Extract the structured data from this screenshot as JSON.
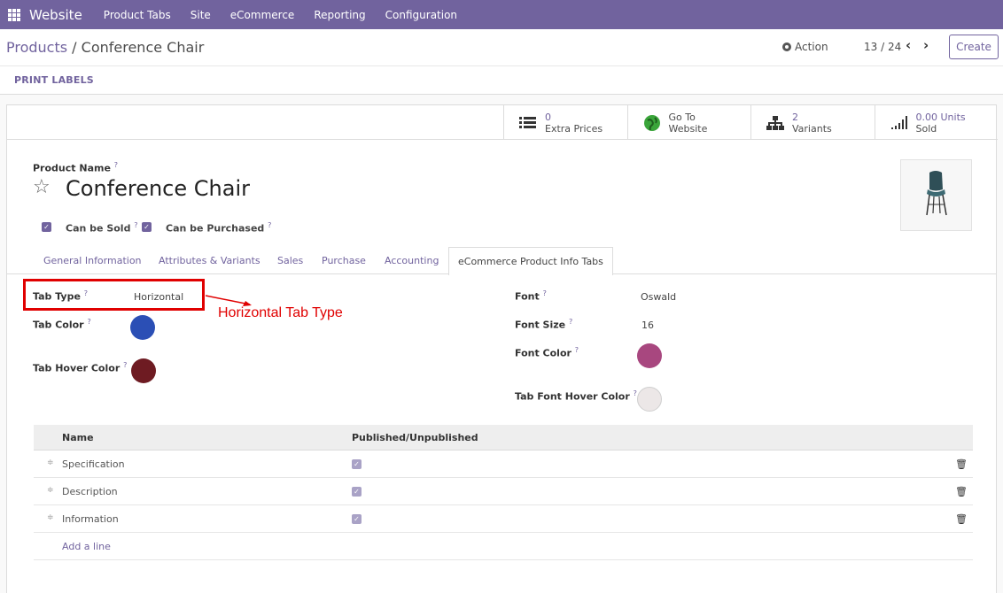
{
  "navbar": {
    "brand": "Website",
    "items": [
      "Product Tabs",
      "Site",
      "eCommerce",
      "Reporting",
      "Configuration"
    ]
  },
  "breadcrumb": {
    "parent": "Products",
    "separator": " / ",
    "current": "Conference Chair"
  },
  "control": {
    "action_label": "Action",
    "pager": "13 / 24",
    "prev_icon": "chevron-left",
    "next_icon": "chevron-right",
    "create_label": "Create",
    "print_labels": "PRINT LABELS"
  },
  "stat_buttons": [
    {
      "icon": "list-icon",
      "value": "0",
      "label": "Extra Prices"
    },
    {
      "icon": "globe-icon",
      "value": "Go To",
      "label": "Website"
    },
    {
      "icon": "sitemap-icon",
      "value": "2",
      "label": "Variants"
    },
    {
      "icon": "signal-icon",
      "value": "0.00 Units",
      "label": "Sold"
    }
  ],
  "product": {
    "name_label": "Product Name",
    "help_mark": "?",
    "name": "Conference Chair",
    "can_be_sold_label": "Can be Sold",
    "can_be_purchased_label": "Can be Purchased",
    "can_be_sold": true,
    "can_be_purchased": true
  },
  "tabs": [
    "General Information",
    "Attributes & Variants",
    "Sales",
    "Purchase",
    "Accounting",
    "eCommerce Product Info Tabs"
  ],
  "active_tab": "eCommerce Product Info Tabs",
  "fields": {
    "tab_type_label": "Tab Type",
    "tab_type": "Horizontal",
    "tab_color_label": "Tab Color",
    "tab_color": "#2b4fb5",
    "tab_hover_color_label": "Tab Hover Color",
    "tab_hover_color": "#6e1b22",
    "font_label": "Font",
    "font": "Oswald",
    "font_size_label": "Font Size",
    "font_size": "16",
    "font_color_label": "Font Color",
    "font_color": "#a8477f",
    "tab_font_hover_color_label": "Tab Font Hover Color",
    "tab_font_hover_color": "#ece7e7"
  },
  "annotation": "Horizontal Tab Type",
  "table": {
    "headers": [
      "Name",
      "Published/Unpublished"
    ],
    "rows": [
      {
        "name": "Specification",
        "published": true
      },
      {
        "name": "Description",
        "published": true
      },
      {
        "name": "Information",
        "published": true
      }
    ],
    "add_line": "Add a line"
  },
  "colors": {
    "brand": "#71639e",
    "annotation": "#e00000"
  }
}
